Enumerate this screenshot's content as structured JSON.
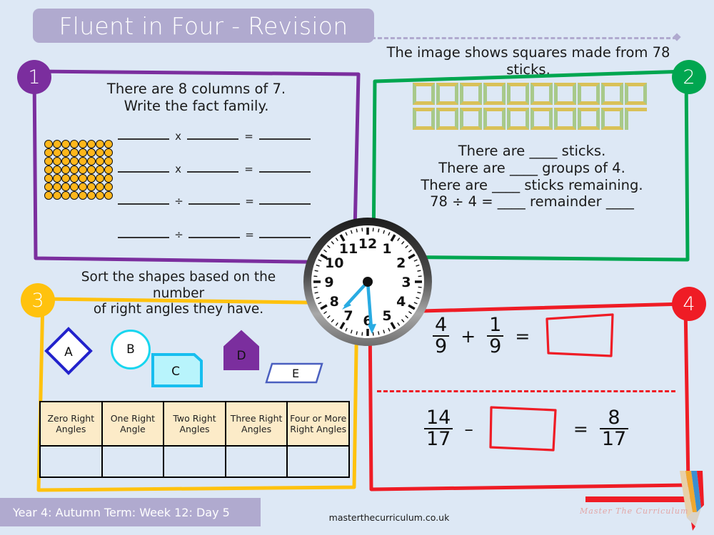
{
  "page": {
    "background_color": "#DDE8F5",
    "title": "Fluent in Four - Revision",
    "title_bar_color": "#B0AACF",
    "footer_label": "Year 4: Autumn Term: Week 12: Day 5",
    "site_url": "masterthecurriculum.co.uk",
    "brand_mark": "Master  The  Curriculum"
  },
  "clock": {
    "name": "analogue-clock",
    "hour_hand_points_to": 8,
    "minute_hand_points_to": 6,
    "time_reading": "7:30",
    "hand_color": "#29ABE2",
    "numerals": [
      "1",
      "2",
      "3",
      "4",
      "5",
      "6",
      "7",
      "8",
      "9",
      "10",
      "11",
      "12"
    ]
  },
  "questions": [
    {
      "number": "1",
      "accent_color": "#7B2E9E",
      "prompt_lines": [
        "There are 8 columns of 7.",
        "Write the fact family."
      ],
      "array": {
        "columns": 8,
        "rows": 7,
        "dot_color": "#FFB71B",
        "total": 56
      },
      "fact_family_rows": [
        {
          "op": "x"
        },
        {
          "op": "x"
        },
        {
          "op": "÷"
        },
        {
          "op": "÷"
        }
      ],
      "equals_symbol": "="
    },
    {
      "number": "2",
      "accent_color": "#00A650",
      "caption": "The image shows squares made from 78 sticks.",
      "squares": {
        "row1_count": 10,
        "row2_count": 9,
        "partial_corner": true,
        "stick_color_horizontal": "#D9C158",
        "stick_color_vertical": "#A8C98A"
      },
      "lines": [
        "There are ____ sticks.",
        "There are ____ groups of 4.",
        "There are ____ sticks remaining.",
        "78 ÷ 4 = ____ remainder ____"
      ]
    },
    {
      "number": "3",
      "accent_color": "#FFC20E",
      "prompt_lines": [
        "Sort the shapes based on the number",
        "of right angles they have."
      ],
      "shapes": [
        {
          "label": "A",
          "kind": "diamond",
          "stroke": "#2222CC",
          "fill": "#FFFFFF"
        },
        {
          "label": "B",
          "kind": "circle",
          "stroke": "#17D6EF",
          "fill": "#FFFFFF"
        },
        {
          "label": "C",
          "kind": "clipped-rectangle",
          "stroke": "#17BEEF",
          "fill": "#B8F4FC"
        },
        {
          "label": "D",
          "kind": "house-pentagon",
          "stroke": "#7B2E9E",
          "fill": "#7B2E9E"
        },
        {
          "label": "E",
          "kind": "parallelogram",
          "stroke": "#4A5FBF",
          "fill": "#FFFFFF"
        }
      ],
      "table": {
        "header_bg": "#FCEBC8",
        "headers": [
          "Zero Right Angles",
          "One Right Angle",
          "Two Right Angles",
          "Three Right Angles",
          "Four or More Right Angles"
        ],
        "answer_row": [
          "",
          "",
          "",
          "",
          ""
        ]
      }
    },
    {
      "number": "4",
      "accent_color": "#EF1C25",
      "equation_1": {
        "left_fraction": {
          "numerator": "4",
          "denominator": "9"
        },
        "operator": "+",
        "right_fraction": {
          "numerator": "1",
          "denominator": "9"
        },
        "equals": "=",
        "answer": "answer-box"
      },
      "equation_2": {
        "left_fraction": {
          "numerator": "14",
          "denominator": "17"
        },
        "operator": "–",
        "missing": "answer-box",
        "equals": "=",
        "result_fraction": {
          "numerator": "8",
          "denominator": "17"
        }
      }
    }
  ]
}
